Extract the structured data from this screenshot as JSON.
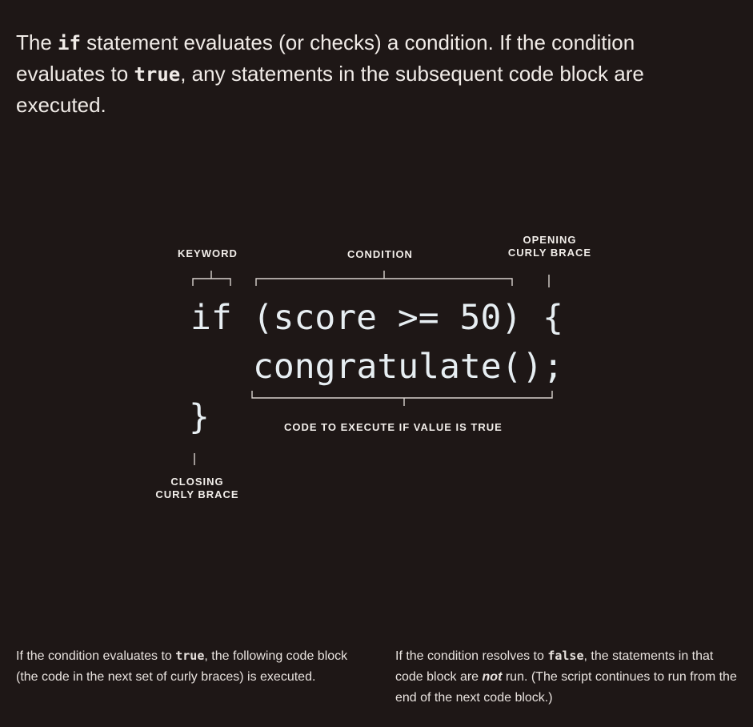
{
  "intro": {
    "part1": "The ",
    "keyword": "if",
    "part2": " statement evaluates (or checks) a condition. If the condition evaluates to ",
    "value": "true",
    "part3": ", any statements in the subsequent code block are executed."
  },
  "labels": {
    "keyword": "KEYWORD",
    "condition": "CONDITION",
    "opening_line1": "OPENING",
    "opening_line2": "CURLY BRACE",
    "code_to_execute": "CODE TO EXECUTE IF VALUE IS TRUE",
    "closing_line1": "CLOSING",
    "closing_line2": "CURLY BRACE"
  },
  "code": {
    "keyword": "if",
    "condition": "(score >= 50)",
    "open_brace": "{",
    "body": "congratulate();",
    "close_brace": "}"
  },
  "notes": {
    "left": {
      "part1": "If the condition evaluates to ",
      "value": "true",
      "part2": ", the following code block (the code in the next set of curly braces) is executed."
    },
    "right": {
      "part1": "If the condition resolves to ",
      "value": "false",
      "part2": ", the statements in that code block are ",
      "emphasis": "not",
      "part3": " run. (The script continues to run from the end of the next code block.)"
    }
  }
}
